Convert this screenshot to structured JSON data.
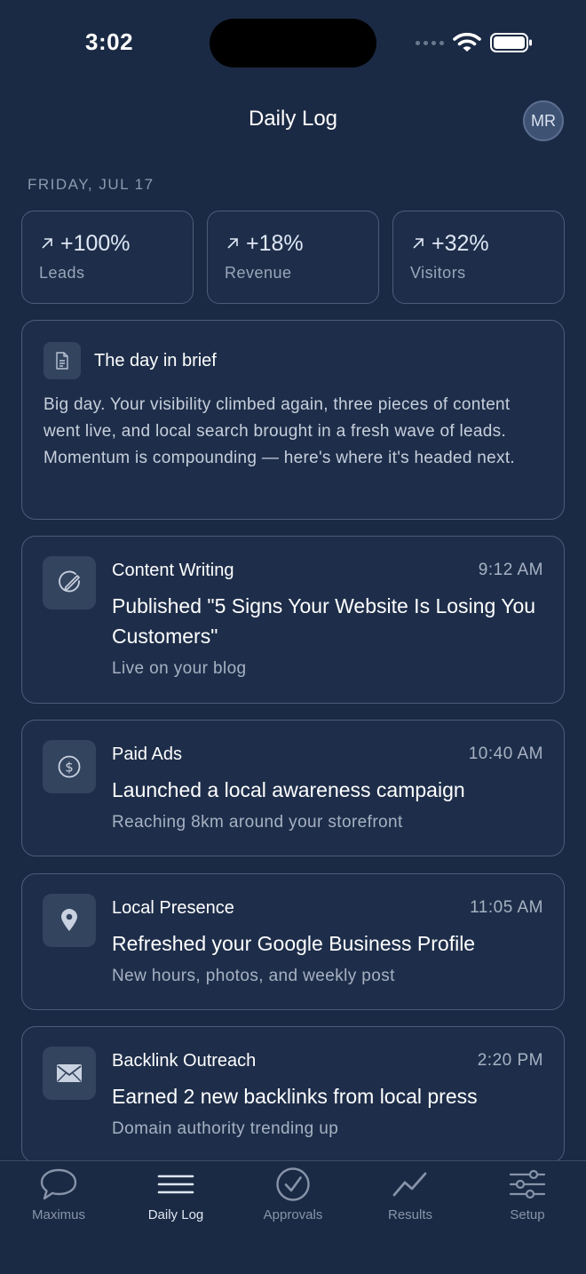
{
  "status_bar": {
    "time": "3:02"
  },
  "header": {
    "title": "Daily Log",
    "avatar_initials": "MR"
  },
  "date_label": "FRIDAY, JUL 17",
  "stats": [
    {
      "value": "+100%",
      "label": "Leads",
      "icon": "arrow-up-right-icon"
    },
    {
      "value": "+18%",
      "label": "Revenue",
      "icon": "arrow-up-right-icon"
    },
    {
      "value": "+32%",
      "label": "Visitors",
      "icon": "arrow-up-right-icon"
    }
  ],
  "brief": {
    "title": "The day in brief",
    "icon": "document-icon",
    "text": "Big day. Your visibility climbed again, three pieces of content went live, and local search brought in a fresh wave of leads. Momentum is compounding — here's where it's headed next."
  },
  "activities": [
    {
      "category": "Content Writing",
      "time": "9:12 AM",
      "title": "Published \"5 Signs Your Website Is Losing You Customers\"",
      "subtitle": "Live on your blog",
      "icon": "pen-icon"
    },
    {
      "category": "Paid Ads",
      "time": "10:40 AM",
      "title": "Launched a local awareness campaign",
      "subtitle": "Reaching 8km around your storefront",
      "icon": "dollar-icon"
    },
    {
      "category": "Local Presence",
      "time": "11:05 AM",
      "title": "Refreshed your Google Business Profile",
      "subtitle": "New hours, photos, and weekly post",
      "icon": "map-pin-icon"
    },
    {
      "category": "Backlink Outreach",
      "time": "2:20 PM",
      "title": "Earned 2 new backlinks from local press",
      "subtitle": "Domain authority trending up",
      "icon": "mail-icon"
    }
  ],
  "tabs": [
    {
      "label": "Maximus",
      "icon": "chat-bubble-icon",
      "active": false
    },
    {
      "label": "Daily Log",
      "icon": "menu-lines-icon",
      "active": true
    },
    {
      "label": "Approvals",
      "icon": "check-circle-icon",
      "active": false
    },
    {
      "label": "Results",
      "icon": "trend-line-icon",
      "active": false
    },
    {
      "label": "Setup",
      "icon": "sliders-icon",
      "active": false
    }
  ],
  "colors": {
    "background": "#1b2a44",
    "card": "#1e2e4a",
    "border": "#4c5c78",
    "muted_text": "#a7b1c2"
  }
}
